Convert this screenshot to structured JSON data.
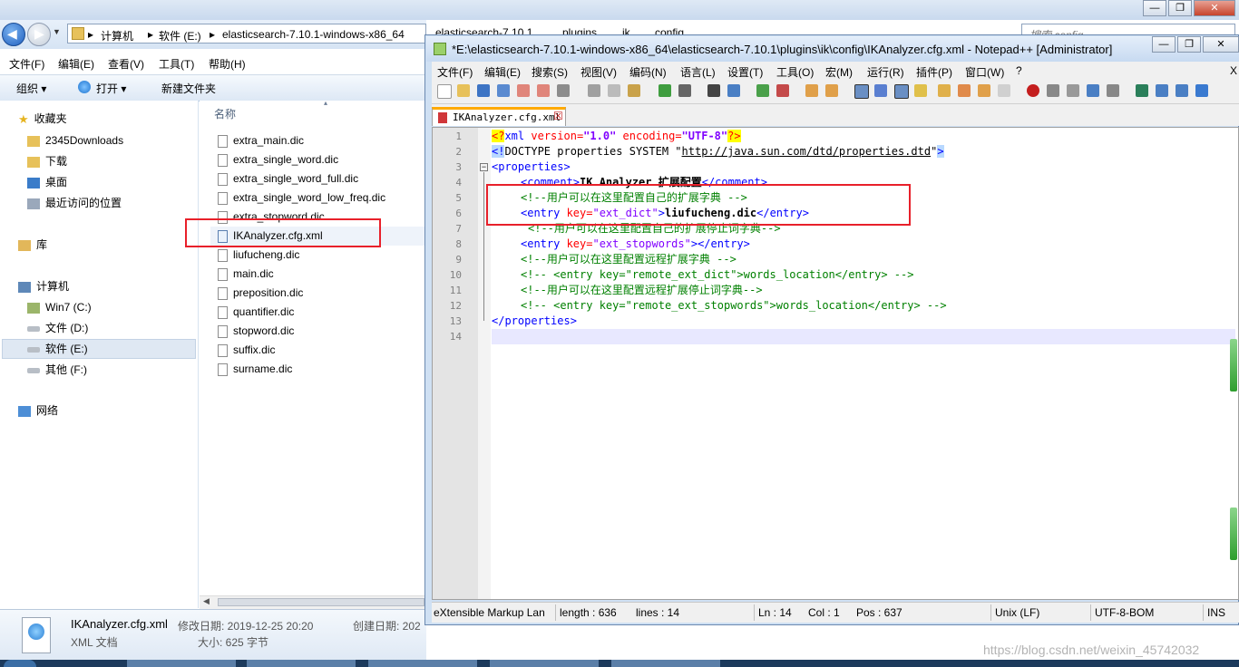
{
  "explorer": {
    "title_search_placeholder": "搜索 config",
    "breadcrumbs": [
      "计算机",
      "软件 (E:)",
      "elasticsearch-7.10.1-windows-x86_64",
      "elasticsearch-7.10.1",
      "plugins",
      "ik",
      "config"
    ],
    "menu": [
      "文件(F)",
      "编辑(E)",
      "查看(V)",
      "工具(T)",
      "帮助(H)"
    ],
    "toolbar": {
      "organize": "组织",
      "open": "打开",
      "new_folder": "新建文件夹"
    },
    "nav": {
      "favorites": "收藏夹",
      "favorites_items": [
        "2345Downloads",
        "下载",
        "桌面",
        "最近访问的位置"
      ],
      "library": "库",
      "computer": "计算机",
      "drives": [
        "Win7 (C:)",
        "文件 (D:)",
        "软件 (E:)",
        "其他 (F:)"
      ],
      "network": "网络"
    },
    "column_header": "名称",
    "files": [
      "extra_main.dic",
      "extra_single_word.dic",
      "extra_single_word_full.dic",
      "extra_single_word_low_freq.dic",
      "extra_stopword.dic",
      "IKAnalyzer.cfg.xml",
      "liufucheng.dic",
      "main.dic",
      "preposition.dic",
      "quantifier.dic",
      "stopword.dic",
      "suffix.dic",
      "surname.dic"
    ],
    "details": {
      "name": "IKAnalyzer.cfg.xml",
      "type": "XML 文档",
      "modified_label": "修改日期: 2019-12-25 20:20",
      "size_label": "大小: 625 字节",
      "created_label": "创建日期: 202"
    }
  },
  "npp": {
    "title": "*E:\\elasticsearch-7.10.1-windows-x86_64\\elasticsearch-7.10.1\\plugins\\ik\\config\\IKAnalyzer.cfg.xml - Notepad++ [Administrator]",
    "menu": [
      "文件(F)",
      "编辑(E)",
      "搜索(S)",
      "视图(V)",
      "编码(N)",
      "语言(L)",
      "设置(T)",
      "工具(O)",
      "宏(M)",
      "运行(R)",
      "插件(P)",
      "窗口(W)",
      "?"
    ],
    "close_x": "X",
    "tab_label": "IKAnalyzer.cfg.xml",
    "line_numbers": [
      "1",
      "2",
      "3",
      "4",
      "5",
      "6",
      "7",
      "8",
      "9",
      "10",
      "11",
      "12",
      "13",
      "14"
    ],
    "code": {
      "l1_pi_open": "<?",
      "l1_name": "xml",
      "l1_attr1": " version=",
      "l1_val1": "\"1.0\"",
      "l1_attr2": " encoding=",
      "l1_val2": "\"UTF-8\"",
      "l1_pi_close": "?>",
      "l2_open": "<!",
      "l2_text": "DOCTYPE properties SYSTEM \"",
      "l2_url": "http://java.sun.com/dtd/properties.dtd",
      "l2_q": "\"",
      "l2_close": ">",
      "l3": "<properties>",
      "l4_tag_open": "<comment>",
      "l4_text": "IK Analyzer 扩展配置",
      "l4_tag_close": "</comment>",
      "l5": "<!--用户可以在这里配置自己的扩展字典 -->",
      "l6_tag": "<entry",
      "l6_attr": " key=",
      "l6_val": "\"ext_dict\"",
      "l6_gt": ">",
      "l6_text": "liufucheng.dic",
      "l6_close": "</entry>",
      "l7": "<!--用户可以在这里配置自己的扩展停止词字典-->",
      "l8_tag": "<entry",
      "l8_attr": " key=",
      "l8_val": "\"ext_stopwords\"",
      "l8_close": "></entry>",
      "l9": "<!--用户可以在这里配置远程扩展字典 -->",
      "l10": "<!-- <entry key=\"remote_ext_dict\">words_location</entry> -->",
      "l11": "<!--用户可以在这里配置远程扩展停止词字典-->",
      "l12": "<!-- <entry key=\"remote_ext_stopwords\">words_location</entry> -->",
      "l13": "</properties>"
    },
    "status": {
      "lang": "eXtensible Markup Lan",
      "length": "length : 636",
      "lines": "lines : 14",
      "ln": "Ln : 14",
      "col": "Col : 1",
      "pos": "Pos : 637",
      "eol": "Unix (LF)",
      "encoding": "UTF-8-BOM",
      "mode": "INS"
    }
  },
  "watermark": "https://blog.csdn.net/weixin_45742032",
  "taskbar": {
    "time_fragment_1": "1203",
    "time_fragment_2": "14:23 周"
  },
  "colors": {
    "red_highlight": "#e8202a",
    "tag_blue": "#0000ff",
    "attr_red": "#ff0000",
    "value_purple": "#8000ff",
    "comment_green": "#008000"
  }
}
